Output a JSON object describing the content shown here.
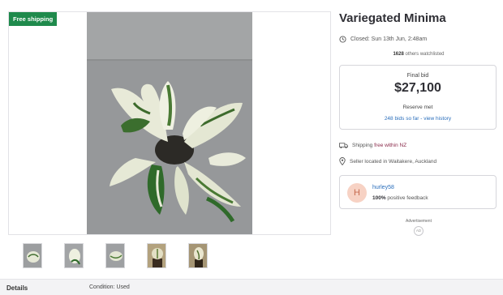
{
  "listing": {
    "title": "Variegated Minima",
    "free_shipping_badge": "Free shipping",
    "closed_text": "Closed: Sun 13th Jun, 2:48am",
    "watchlisted_count": "1628",
    "watchlisted_suffix": " others watchlisted"
  },
  "bid": {
    "label": "Final bid",
    "amount": "$27,100",
    "reserve_text": "Reserve met",
    "history_link": "248 bids so far - view history"
  },
  "shipping": {
    "prefix": "Shipping ",
    "highlight": "free within NZ"
  },
  "location": {
    "text": "Seller located in Waitakere, Auckland"
  },
  "seller": {
    "avatar_letter": "H",
    "username": "hurley58",
    "feedback_percent": "100%",
    "feedback_suffix": " positive feedback"
  },
  "ad": {
    "label": "Advertisement",
    "badge": "AD"
  },
  "details": {
    "heading": "Details",
    "condition_label": "Condition:",
    "condition_value": "Used"
  },
  "colors": {
    "badge_green": "#1f8a4c",
    "link_blue": "#2a6ebb",
    "ship_highlight": "#8a2a4a",
    "avatar_bg": "#f7d2c4"
  },
  "thumbnails": [
    "plant-thumb-1",
    "plant-thumb-2",
    "plant-thumb-3",
    "plant-thumb-4",
    "plant-thumb-5"
  ]
}
